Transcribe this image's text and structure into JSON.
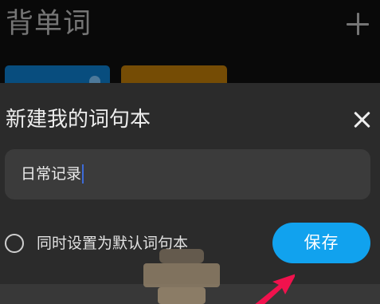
{
  "header": {
    "title": "背单词",
    "add_icon": "plus-icon"
  },
  "cards": [
    {
      "color": "#0a5b94"
    },
    {
      "color": "#8a5a06"
    }
  ],
  "dialog": {
    "title": "新建我的词句本",
    "close_icon": "close-icon",
    "name_field": {
      "value": "日常记录"
    },
    "default_option": {
      "label": "同时设置为默认词句本",
      "checked": false
    },
    "save_label": "保存",
    "accent_color": "#11a2ee"
  },
  "annotation": {
    "arrow_color": "#f0124d"
  }
}
